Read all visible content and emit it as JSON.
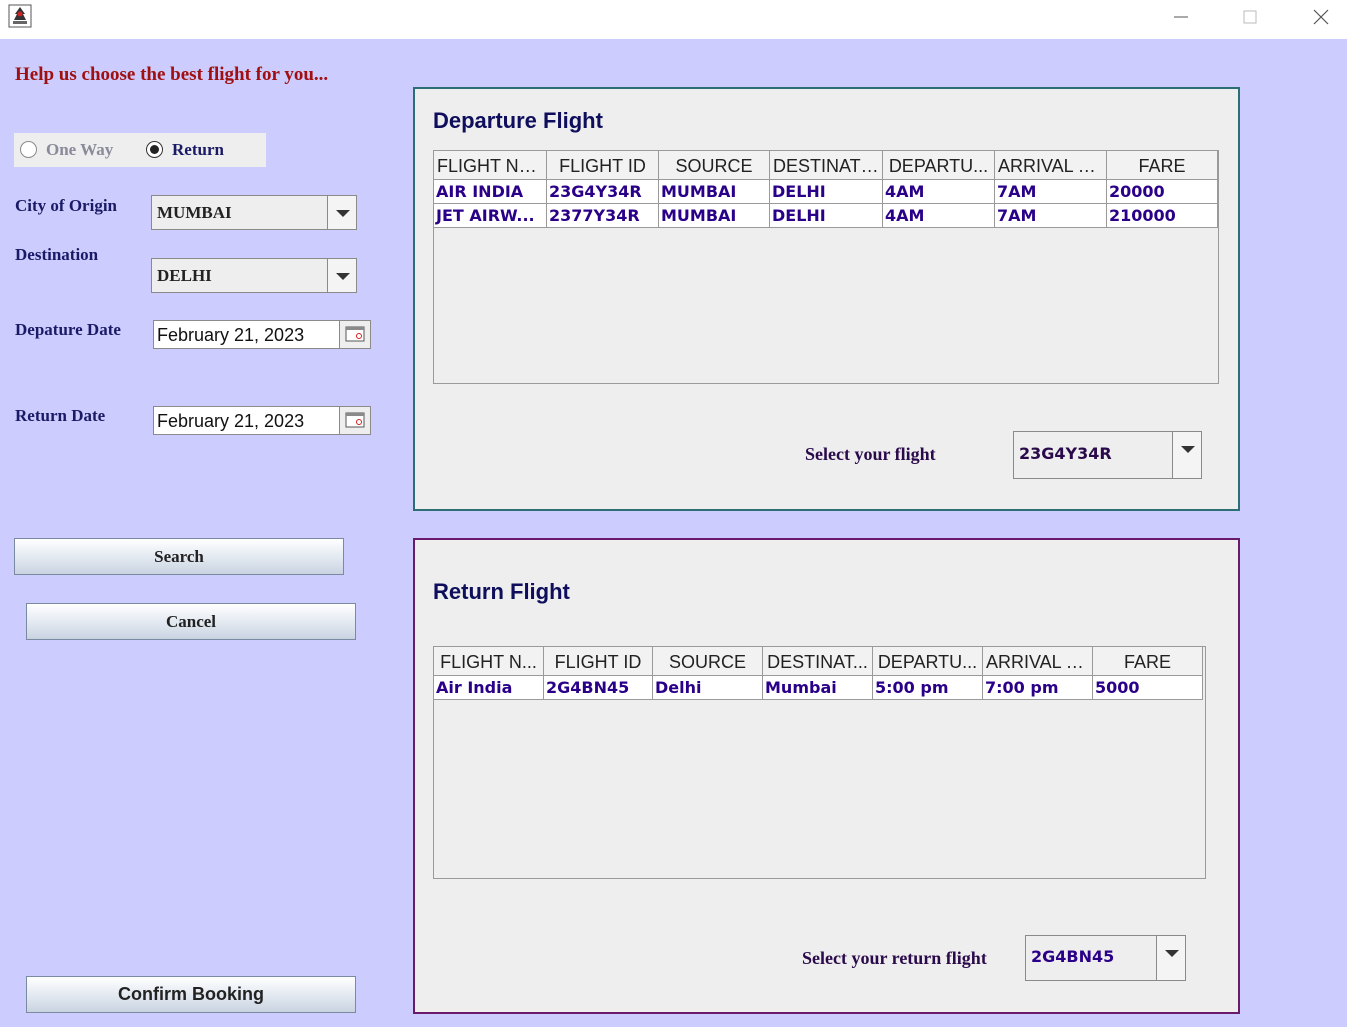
{
  "heading": "Help us choose the best flight for you...",
  "trip_type": {
    "options": [
      {
        "label": "One Way",
        "checked": false
      },
      {
        "label": "Return",
        "checked": true
      }
    ]
  },
  "form": {
    "origin_label": "City of Origin",
    "origin_value": "MUMBAI",
    "destination_label": "Destination",
    "destination_value": "DELHI",
    "departure_date_label": "Depature Date",
    "departure_date_value": "February 21, 2023",
    "return_date_label": "Return Date",
    "return_date_value": "February 21, 2023"
  },
  "buttons": {
    "search": "Search",
    "cancel": "Cancel",
    "confirm": "Confirm Booking"
  },
  "departure": {
    "title": "Departure Flight",
    "columns": [
      "FLIGHT NA...",
      "FLIGHT ID",
      "SOURCE",
      "DESTINATI...",
      "DEPARTU...",
      "ARRIVAL TI...",
      "FARE"
    ],
    "rows": [
      [
        "AIR INDIA",
        "23G4Y34R",
        "MUMBAI",
        "DELHI",
        "4AM",
        "7AM",
        "20000"
      ],
      [
        "JET AIRW...",
        "2377Y34R",
        "MUMBAI",
        "DELHI",
        "4AM",
        "7AM",
        "210000"
      ]
    ],
    "select_label": "Select your flight",
    "selected_flight": "23G4Y34R"
  },
  "return_flight": {
    "title": "Return Flight",
    "columns": [
      "FLIGHT N...",
      "FLIGHT ID",
      "SOURCE",
      "DESTINAT...",
      "DEPARTU...",
      "ARRIVAL T...",
      "FARE"
    ],
    "rows": [
      [
        "Air India",
        "2G4BN45",
        "Delhi",
        "Mumbai",
        "5:00 pm",
        "7:00 pm",
        "5000"
      ]
    ],
    "select_label": "Select your return flight",
    "selected_flight": "2G4BN45"
  },
  "colors": {
    "background": "#ccccfe",
    "heading": "#a01010",
    "label": "#1a1a66",
    "table_text": "#2a0088",
    "departure_border": "#2b6f74",
    "return_border": "#6a1a6a"
  },
  "icons": {
    "app": "java-duke-icon",
    "minimize": "minimize-icon",
    "maximize": "maximize-icon",
    "close": "close-icon",
    "calendar": "calendar-icon",
    "dropdown": "chevron-down-icon"
  }
}
